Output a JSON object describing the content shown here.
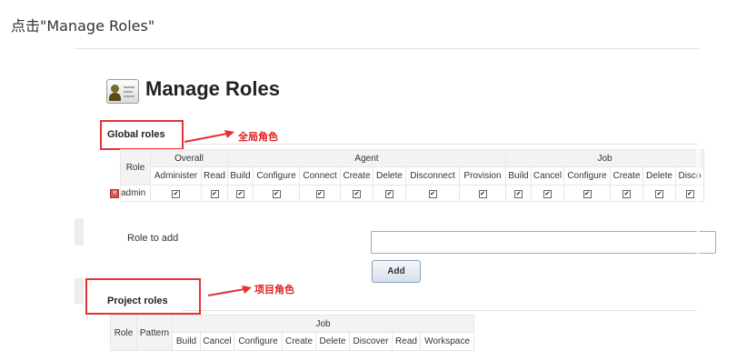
{
  "caption": "点击\"Manage Roles\"",
  "page": {
    "title": "Manage Roles",
    "icon": "user-admin-icon"
  },
  "global_roles": {
    "title": "Global roles",
    "annotation": "全局角色",
    "role_header": "Role",
    "groups": [
      "Overall",
      "Agent",
      "Job"
    ],
    "columns": [
      "Administer",
      "Read",
      "Build",
      "Configure",
      "Connect",
      "Create",
      "Delete",
      "Disconnect",
      "Provision",
      "Build",
      "Cancel",
      "Configure",
      "Create",
      "Delete",
      "Disco"
    ],
    "rows": [
      {
        "name": "admin",
        "checks": [
          true,
          true,
          true,
          true,
          true,
          true,
          true,
          true,
          true,
          true,
          true,
          true,
          true,
          true,
          true
        ]
      }
    ]
  },
  "role_to_add": {
    "label": "Role to add",
    "value": "",
    "button_label": "Add"
  },
  "project_roles": {
    "title": "Project roles",
    "annotation": "项目角色",
    "role_header": "Role",
    "pattern_header": "Pattern",
    "group": "Job",
    "columns": [
      "Build",
      "Cancel",
      "Configure",
      "Create",
      "Delete",
      "Discover",
      "Read",
      "Workspace"
    ]
  },
  "colors": {
    "annotation_red": "#e53333",
    "button_border": "#8aa0b8"
  }
}
